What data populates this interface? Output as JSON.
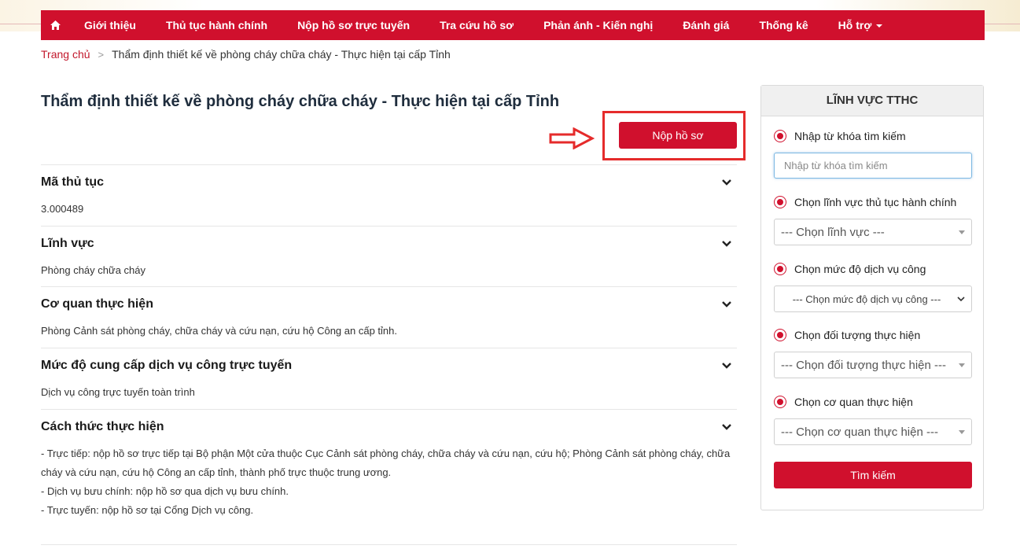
{
  "nav": {
    "items": [
      {
        "label": "Giới thiệu"
      },
      {
        "label": "Thủ tục hành chính"
      },
      {
        "label": "Nộp hồ sơ trực tuyến"
      },
      {
        "label": "Tra cứu hồ sơ"
      },
      {
        "label": "Phản ánh - Kiến nghị"
      },
      {
        "label": "Đánh giá"
      },
      {
        "label": "Thống kê"
      },
      {
        "label": "Hỗ trợ"
      }
    ]
  },
  "breadcrumb": {
    "home": "Trang chủ",
    "current": "Thẩm định thiết kế về phòng cháy chữa cháy - Thực hiện tại cấp Tỉnh"
  },
  "main": {
    "title": "Thẩm định thiết kế về phòng cháy chữa cháy - Thực hiện tại cấp Tỉnh",
    "submit_label": "Nộp hồ sơ",
    "sections": [
      {
        "title": "Mã thủ tục",
        "content": "3.000489"
      },
      {
        "title": "Lĩnh vực",
        "content": "Phòng cháy chữa cháy"
      },
      {
        "title": "Cơ quan thực hiện",
        "content": "Phòng Cảnh sát phòng cháy, chữa cháy và cứu nạn, cứu hộ Công an cấp tỉnh."
      },
      {
        "title": "Mức độ cung cấp dịch vụ công trực tuyến",
        "content": "Dịch vụ công trực tuyến toàn trình"
      },
      {
        "title": "Cách thức thực hiện",
        "lines": [
          "- Trực tiếp: nộp hồ sơ trực tiếp tại Bộ phận Một cửa thuộc Cục Cảnh sát phòng cháy, chữa cháy và cứu nạn, cứu hộ; Phòng Cảnh sát phòng cháy, chữa cháy và cứu nạn, cứu hộ Công an cấp tỉnh, thành phố trực thuộc trung ương.",
          "- Dịch vụ bưu chính: nộp hồ sơ qua dịch vụ bưu chính.",
          "- Trực tuyến: nộp hồ sơ tại Cổng Dịch vụ công."
        ]
      }
    ]
  },
  "sidebar": {
    "header": "LĨNH VỰC TTHC",
    "keyword_label": "Nhập từ khóa tìm kiếm",
    "keyword_placeholder": "Nhập từ khóa tìm kiếm",
    "field_label": "Chọn lĩnh vực thủ tục hành chính",
    "field_value": "--- Chọn lĩnh vực ---",
    "level_label": "Chọn mức độ dịch vụ công",
    "level_value": "--- Chọn mức độ dịch vụ công ---",
    "target_label": "Chọn đối tượng thực hiện",
    "target_value": "--- Chọn đối tượng thực hiện ---",
    "agency_label": "Chọn cơ quan thực hiện",
    "agency_value": "--- Chọn cơ quan thực hiện ---",
    "search_button": "Tìm kiếm"
  },
  "colors": {
    "brand_red": "#d0102d",
    "highlight": "#e52b2b"
  }
}
